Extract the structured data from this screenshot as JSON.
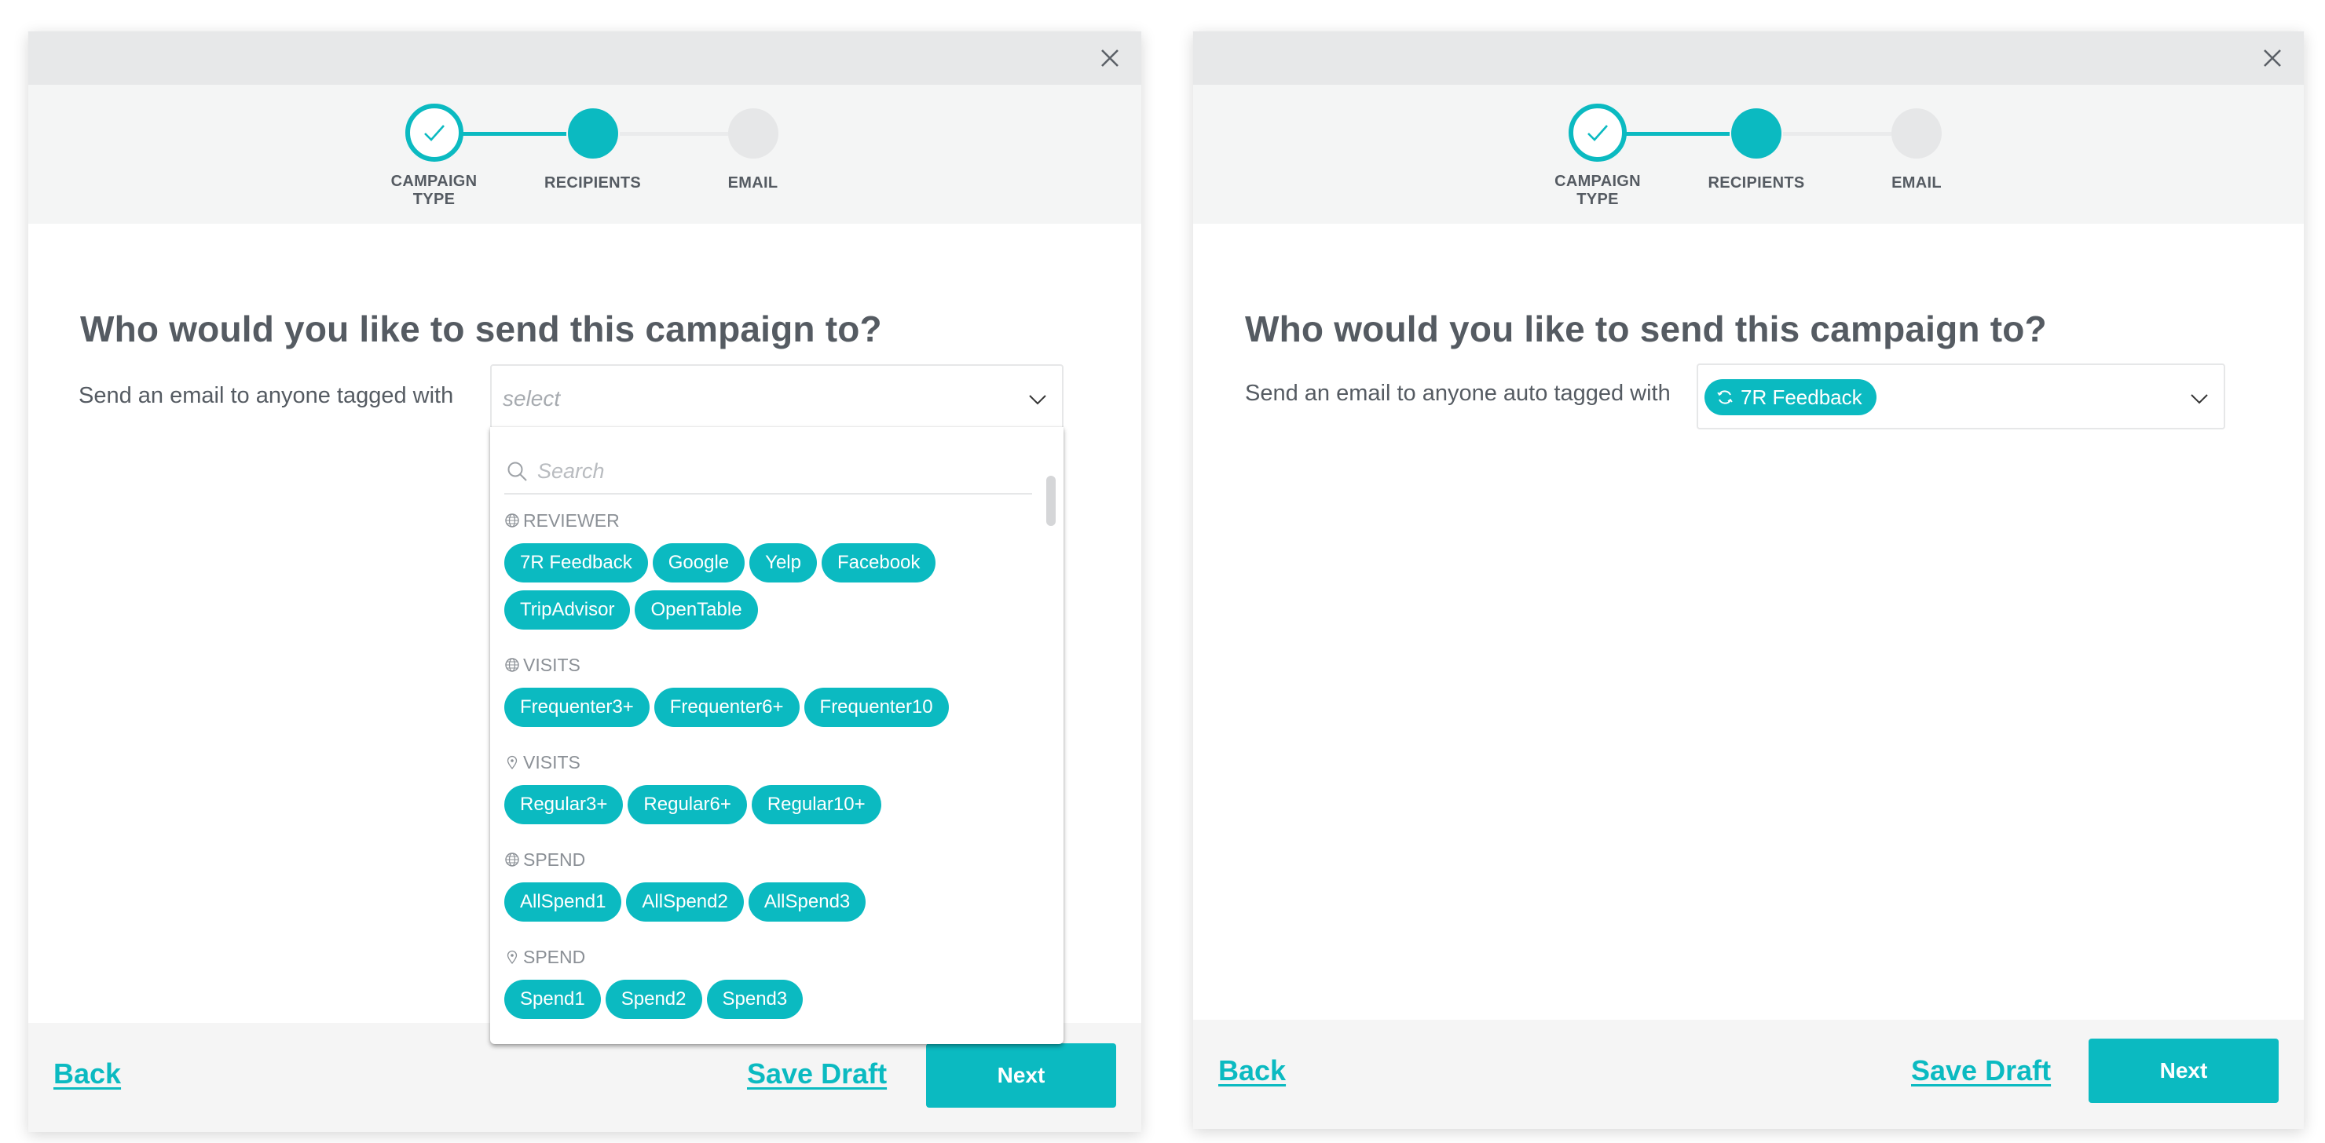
{
  "colors": {
    "accent": "#0bbac1",
    "text": "#555b62",
    "header_bg": "#e7e8e9",
    "stepper_bg": "#f4f5f5",
    "footer_bg": "#f5f5f5"
  },
  "stepper": {
    "steps": [
      {
        "label_line1": "CAMPAIGN",
        "label_line2": "TYPE",
        "state": "done"
      },
      {
        "label_line1": "RECIPIENTS",
        "label_line2": "",
        "state": "active"
      },
      {
        "label_line1": "EMAIL",
        "label_line2": "",
        "state": "todo"
      }
    ]
  },
  "left_panel": {
    "heading": "Who would you like to send this campaign to?",
    "field_label": "Send an email to anyone tagged with",
    "select_placeholder": "select",
    "dropdown": {
      "search_placeholder": "Search",
      "groups": [
        {
          "icon": "globe-icon",
          "title": "REVIEWER",
          "chips": [
            "7R Feedback",
            "Google",
            "Yelp",
            "Facebook",
            "TripAdvisor",
            "OpenTable"
          ]
        },
        {
          "icon": "globe-icon",
          "title": "VISITS",
          "chips": [
            "Frequenter3+",
            "Frequenter6+",
            "Frequenter10"
          ]
        },
        {
          "icon": "location-pin-icon",
          "title": "VISITS",
          "chips": [
            "Regular3+",
            "Regular6+",
            "Regular10+"
          ]
        },
        {
          "icon": "globe-icon",
          "title": "SPEND",
          "chips": [
            "AllSpend1",
            "AllSpend2",
            "AllSpend3"
          ]
        },
        {
          "icon": "location-pin-icon",
          "title": "SPEND",
          "chips": [
            "Spend1",
            "Spend2",
            "Spend3"
          ]
        }
      ]
    },
    "footer": {
      "back": "Back",
      "save_draft": "Save Draft",
      "next": "Next"
    }
  },
  "right_panel": {
    "heading": "Who would you like to send this campaign to?",
    "field_label": "Send an email to anyone auto tagged with",
    "selected_chip": {
      "icon": "sync-icon",
      "label": "7R Feedback"
    },
    "footer": {
      "back": "Back",
      "save_draft": "Save Draft",
      "next": "Next"
    }
  }
}
